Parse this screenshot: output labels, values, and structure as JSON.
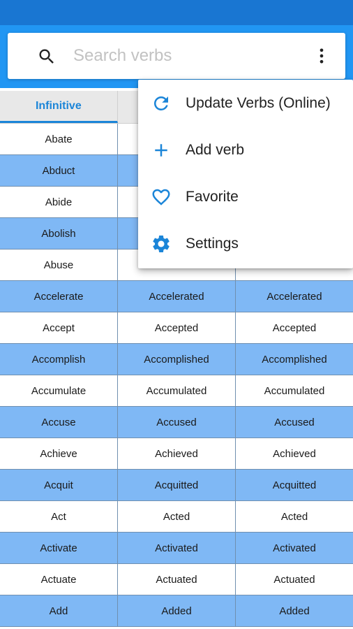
{
  "search": {
    "placeholder": "Search verbs"
  },
  "table": {
    "headers": [
      "Infinitive",
      "",
      ""
    ],
    "rows": [
      [
        "Abate",
        "",
        ""
      ],
      [
        "Abduct",
        "",
        ""
      ],
      [
        "Abide",
        "",
        ""
      ],
      [
        "Abolish",
        "",
        ""
      ],
      [
        "Abuse",
        "",
        ""
      ],
      [
        "Accelerate",
        "Accelerated",
        "Accelerated"
      ],
      [
        "Accept",
        "Accepted",
        "Accepted"
      ],
      [
        "Accomplish",
        "Accomplished",
        "Accomplished"
      ],
      [
        "Accumulate",
        "Accumulated",
        "Accumulated"
      ],
      [
        "Accuse",
        "Accused",
        "Accused"
      ],
      [
        "Achieve",
        "Achieved",
        "Achieved"
      ],
      [
        "Acquit",
        "Acquitted",
        "Acquitted"
      ],
      [
        "Act",
        "Acted",
        "Acted"
      ],
      [
        "Activate",
        "Activated",
        "Activated"
      ],
      [
        "Actuate",
        "Actuated",
        "Actuated"
      ],
      [
        "Add",
        "Added",
        "Added"
      ]
    ]
  },
  "menu": {
    "items": [
      {
        "label": "Update Verbs (Online)",
        "icon": "refresh-icon"
      },
      {
        "label": "Add verb",
        "icon": "plus-icon"
      },
      {
        "label": "Favorite",
        "icon": "heart-icon"
      },
      {
        "label": "Settings",
        "icon": "gear-icon"
      }
    ]
  },
  "colors": {
    "status_bar": "#1976d2",
    "app_bar": "#2196f3",
    "row_blue": "#7fb8f5",
    "accent": "#1b85d8"
  }
}
